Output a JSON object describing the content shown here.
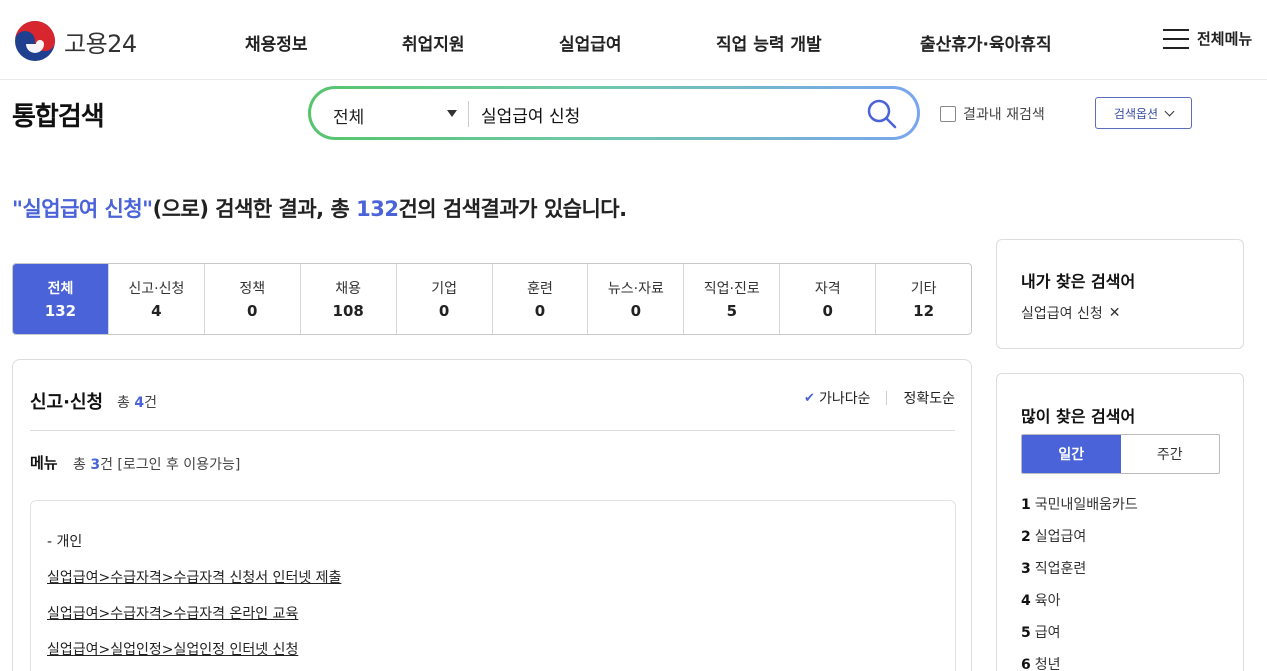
{
  "header": {
    "logo_text": "고용24",
    "nav": [
      "채용정보",
      "취업지원",
      "실업급여",
      "직업 능력 개발",
      "출산휴가·육아휴직"
    ],
    "all_menu": "전체메뉴"
  },
  "search": {
    "page_title": "통합검색",
    "scope": "전체",
    "query": "실업급여 신청",
    "research_label": "결과내 재검색",
    "options_label": "검색옵션"
  },
  "summary": {
    "keyword": "\"실업급여 신청\"",
    "text1": "(으로) 검색한 결과, 총 ",
    "count": "132",
    "text2": "건의 검색결과가 있습니다."
  },
  "categories": [
    {
      "label": "전체",
      "count": "132"
    },
    {
      "label": "신고·신청",
      "count": "4"
    },
    {
      "label": "정책",
      "count": "0"
    },
    {
      "label": "채용",
      "count": "108"
    },
    {
      "label": "기업",
      "count": "0"
    },
    {
      "label": "훈련",
      "count": "0"
    },
    {
      "label": "뉴스·자료",
      "count": "0"
    },
    {
      "label": "직업·진로",
      "count": "5"
    },
    {
      "label": "자격",
      "count": "0"
    },
    {
      "label": "기타",
      "count": "12"
    }
  ],
  "section": {
    "title": "신고·신청",
    "count_prefix": "총 ",
    "count": "4",
    "count_suffix": "건",
    "sort_alpha": "가나다순",
    "sort_accuracy": "정확도순",
    "menu_title": "메뉴",
    "menu_count_prefix": "총 ",
    "menu_count": "3",
    "menu_count_suffix": "건 [로그인 후 이용가능]",
    "group_label": "- 개인",
    "links": [
      "실업급여>수급자격>수급자격 신청서 인터넷 제출",
      "실업급여>수급자격>수급자격 온라인 교육",
      "실업급여>실업인정>실업인정 인터넷 신청"
    ]
  },
  "sidebar": {
    "recent_title": "내가 찾은 검색어",
    "recent_item": "실업급여 신청",
    "popular_title": "많이 찾은 검색어",
    "period_daily": "일간",
    "period_weekly": "주간",
    "ranks": [
      {
        "n": "1",
        "term": "국민내일배움카드"
      },
      {
        "n": "2",
        "term": "실업급여"
      },
      {
        "n": "3",
        "term": "직업훈련"
      },
      {
        "n": "4",
        "term": "육아"
      },
      {
        "n": "5",
        "term": "급여"
      },
      {
        "n": "6",
        "term": "청년"
      }
    ]
  },
  "colors": {
    "accent": "#4a63d8",
    "search_gradient_start": "#55c56b",
    "search_gradient_end": "#7aa5f0"
  }
}
